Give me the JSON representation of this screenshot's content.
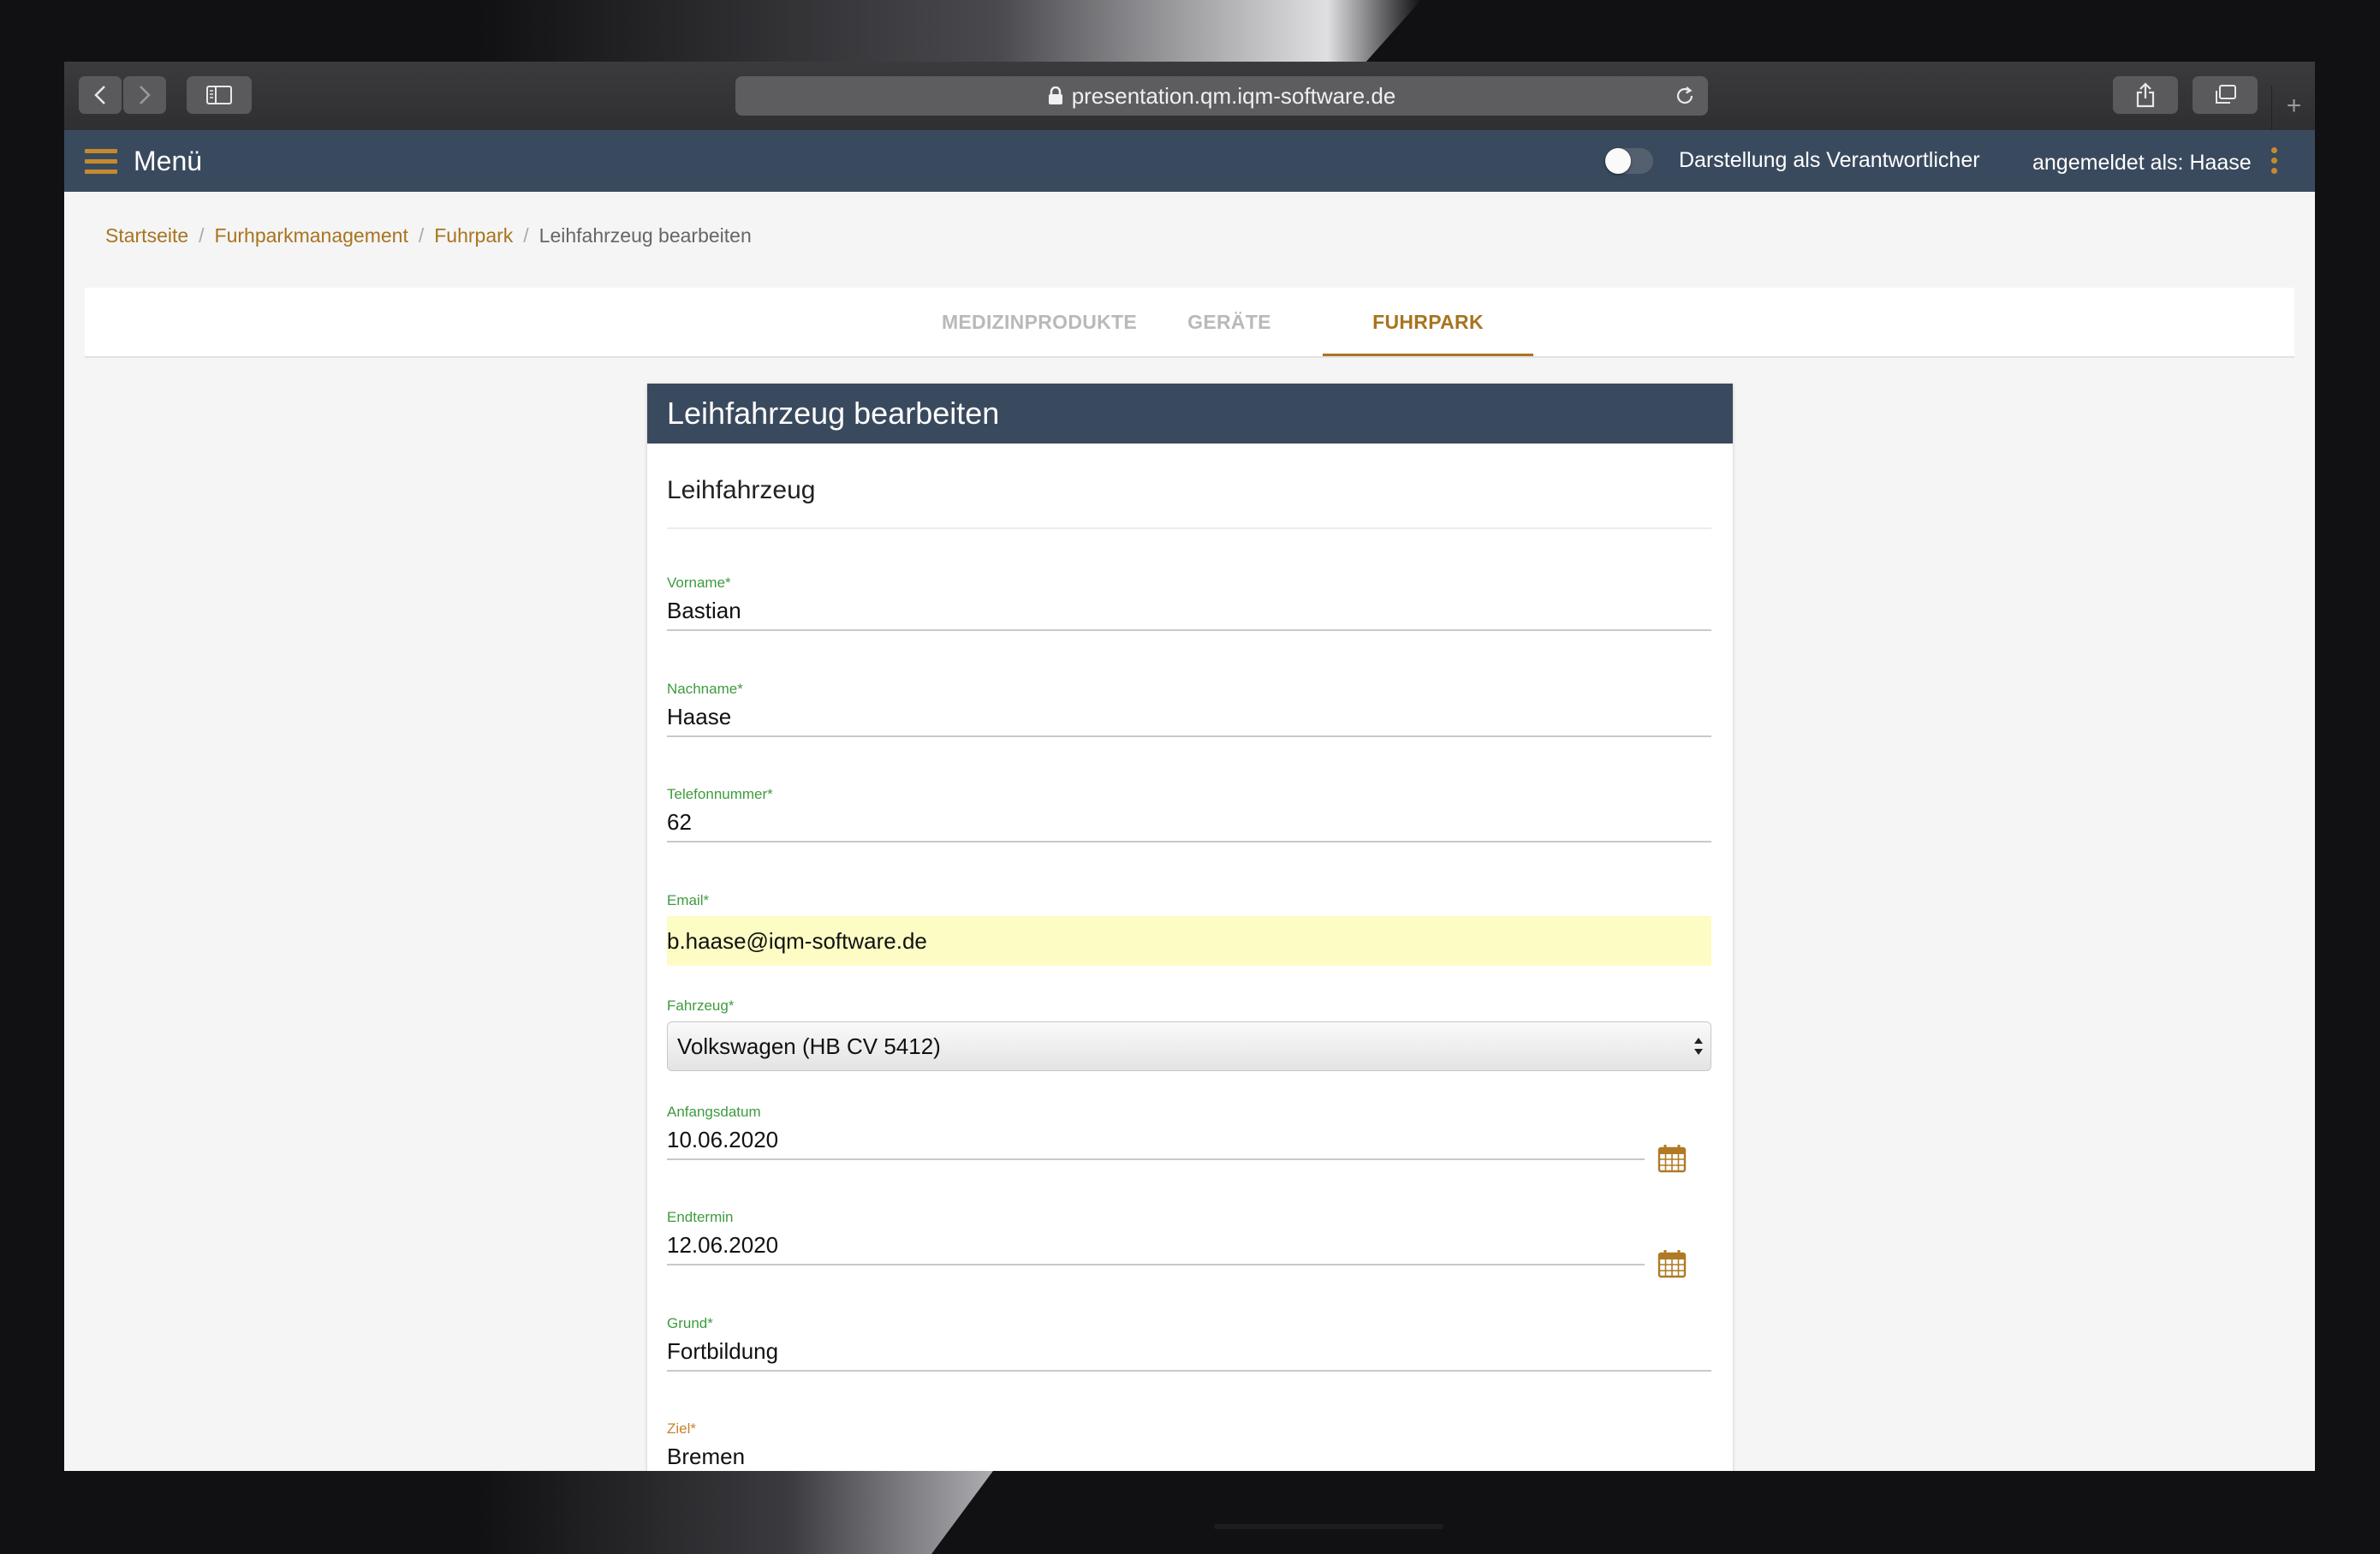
{
  "browser": {
    "url": "presentation.qm.iqm-software.de",
    "new_tab_symbol": "+"
  },
  "appbar": {
    "menu_label": "Menü",
    "toggle_label": "Darstellung als Verantwortlicher",
    "toggle_on": false,
    "logged_in": "angemeldet als: Haase"
  },
  "breadcrumb": {
    "items": [
      "Startseite",
      "Furhparkmanagement",
      "Fuhrpark"
    ],
    "current": "Leihfahrzeug bearbeiten",
    "separator": "/"
  },
  "tabs": [
    {
      "label": "MEDIZINPRODUKTE",
      "active": false
    },
    {
      "label": "GERÄTE",
      "active": false
    },
    {
      "label": "FUHRPARK",
      "active": true
    }
  ],
  "form": {
    "title": "Leihfahrzeug bearbeiten",
    "section": "Leihfahrzeug",
    "fields": {
      "vorname": {
        "label": "Vorname*",
        "value": "Bastian"
      },
      "nachname": {
        "label": "Nachname*",
        "value": "Haase"
      },
      "telefon": {
        "label": "Telefonnummer*",
        "value": "62"
      },
      "email": {
        "label": "Email*",
        "value": "b.haase@iqm-software.de"
      },
      "fahrzeug": {
        "label": "Fahrzeug*",
        "value": "Volkswagen (HB CV 5412)"
      },
      "anfangsdatum": {
        "label": "Anfangsdatum",
        "value": "10.06.2020"
      },
      "endtermin": {
        "label": "Endtermin",
        "value": "12.06.2020"
      },
      "grund": {
        "label": "Grund*",
        "value": "Fortbildung"
      },
      "ziel": {
        "label": "Ziel*",
        "value": "Bremen"
      }
    }
  },
  "colors": {
    "header_bg": "#3a4a5e",
    "accent": "#a8741f",
    "label_green": "#3d9b3d",
    "autofill_bg": "#fcfcc4"
  }
}
